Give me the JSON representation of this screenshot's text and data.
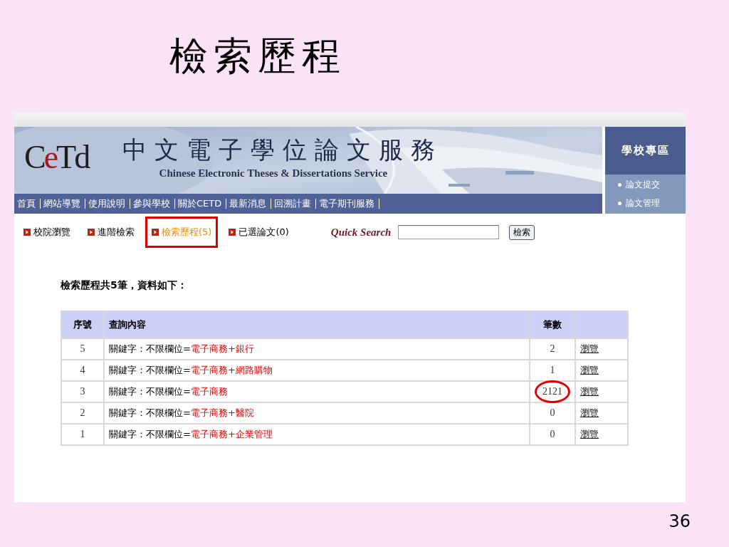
{
  "slide": {
    "title": "檢索歷程",
    "page_number": "36"
  },
  "header": {
    "logo": [
      {
        "text": "C",
        "color": "#1f1f1f"
      },
      {
        "text": "e",
        "color": "#a8151b"
      },
      {
        "text": "Td",
        "color": "#1f1f1f"
      }
    ],
    "title": "中文電子學位論文服務",
    "subtitle": "Chinese Electronic Theses & Dissertations Service",
    "nav": [
      "首頁",
      "網站導覽",
      "使用說明",
      "參與學校",
      "關於CETD",
      "最新消息",
      "回溯計畫",
      "電子期刊服務"
    ],
    "school_zone": {
      "title": "學校專區",
      "items": [
        "論文提交",
        "論文管理"
      ]
    }
  },
  "tabs": [
    {
      "label": "校院瀏覽",
      "selected": false,
      "highlighted": false
    },
    {
      "label": "進階檢索",
      "selected": false,
      "highlighted": false
    },
    {
      "label": "檢索歷程(5)",
      "selected": true,
      "highlighted": true
    },
    {
      "label": "已選論文(0)",
      "selected": false,
      "highlighted": false
    }
  ],
  "quick_search": {
    "logo": "Quick Search",
    "button": "檢索"
  },
  "summary": "檢索歷程共5筆，資料如下：",
  "table": {
    "columns": [
      "序號",
      "查詢內容",
      "筆數"
    ],
    "rows": [
      {
        "index": "5",
        "prefix": "關鍵字：不限欄位=",
        "keyword": "電子商務+銀行",
        "count": "2",
        "action": "瀏覽",
        "circled": false
      },
      {
        "index": "4",
        "prefix": "關鍵字：不限欄位=",
        "keyword": "電子商務+網路購物",
        "count": "1",
        "action": "瀏覽",
        "circled": false
      },
      {
        "index": "3",
        "prefix": "關鍵字：不限欄位=",
        "keyword": "電子商務",
        "count": "2121",
        "action": "瀏覽",
        "circled": true
      },
      {
        "index": "2",
        "prefix": "關鍵字：不限欄位=",
        "keyword": "電子商務+醫院",
        "count": "0",
        "action": "瀏覽",
        "circled": false
      },
      {
        "index": "1",
        "prefix": "關鍵字：不限欄位=",
        "keyword": "電子商務+企業管理",
        "count": "0",
        "action": "瀏覽",
        "circled": false
      }
    ]
  }
}
